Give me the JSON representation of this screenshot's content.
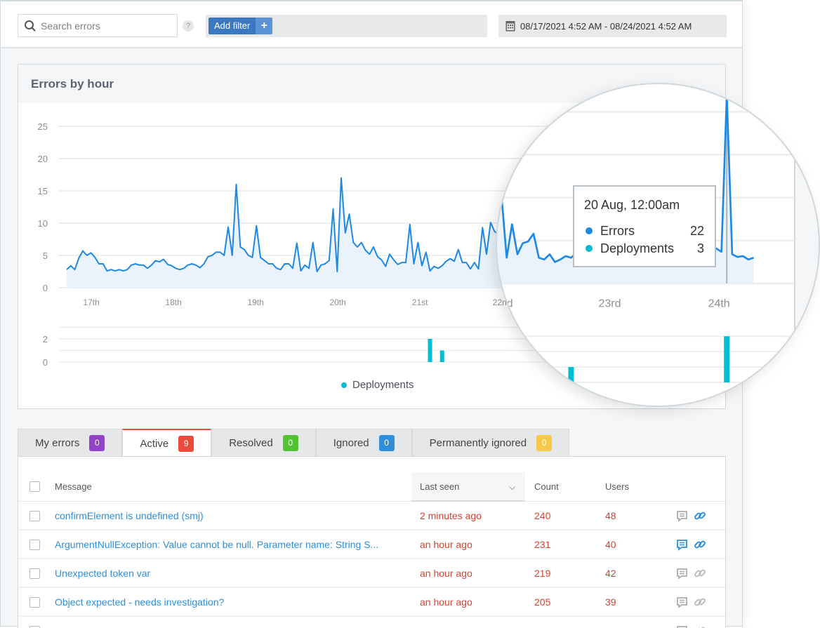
{
  "toolbar": {
    "search_placeholder": "Search errors",
    "help": "?",
    "add_filter": "Add filter",
    "add_filter_plus": "+",
    "date_range": "08/17/2021 4:52 AM - 08/24/2021 4:52 AM"
  },
  "chart_card": {
    "title": "Errors by hour"
  },
  "chart_data": [
    {
      "type": "area",
      "title": "Errors by hour",
      "series": [
        {
          "name": "Errors",
          "color": "#1e88e5",
          "values": [
            2.8,
            3.4,
            2.8,
            4.6,
            5.7,
            5.0,
            5.4,
            4.7,
            3.7,
            3.7,
            2.6,
            2.8,
            2.6,
            2.8,
            2.6,
            2.8,
            3.5,
            3.7,
            3.5,
            3.5,
            3.0,
            3.5,
            4.2,
            4.0,
            4.4,
            3.6,
            3.4,
            3.0,
            2.8,
            3.0,
            3.5,
            3.7,
            3.5,
            3.1,
            3.7,
            4.8,
            5.0,
            5.5,
            5.5,
            5.0,
            9.4,
            5.0,
            16.0,
            6.3,
            5.9,
            5.0,
            4.7,
            9.6,
            4.7,
            4.2,
            3.7,
            3.7,
            3.0,
            2.8,
            3.7,
            3.7,
            3.0,
            6.9,
            2.6,
            3.5,
            3.0,
            7.0,
            2.5,
            3.5,
            3.7,
            4.2,
            12.2,
            2.5,
            17.0,
            8.5,
            11.4,
            7.0,
            6.3,
            7.0,
            5.8,
            5.2,
            6.3,
            4.8,
            4.3,
            3.3,
            5.2,
            4.3,
            3.6,
            3.9,
            3.9,
            9.8,
            3.7,
            7.0,
            3.4,
            5.5,
            2.6,
            3.3,
            3.0,
            3.4,
            4.1,
            4.5,
            4.1,
            5.9,
            3.9,
            3.9,
            2.9,
            3.9,
            2.9,
            9.3,
            5.2,
            10.1,
            8.7,
            8.3,
            10.5,
            3.0,
            6.9,
            3.4,
            4.7,
            4.9,
            5.8,
            3.0,
            2.8,
            3.4,
            2.5,
            2.8,
            3.2,
            3.0,
            3.6,
            4.0,
            3.4,
            3.1,
            2.9,
            3.5,
            4.2,
            3.8,
            3.3,
            3.0,
            2.7,
            3.1,
            3.6,
            4.4,
            3.9,
            3.2,
            3.0,
            3.4,
            3.8,
            3.5,
            3.1,
            2.9,
            3.3,
            3.7,
            4.0,
            3.6,
            4.1,
            3.7,
            22,
            3.4,
            3.1,
            3.2,
            2.8,
            3.0
          ]
        }
      ],
      "x_ticks": [
        "17th",
        "18th",
        "19th",
        "20th",
        "21st",
        "22nd",
        "23rd",
        "24th"
      ],
      "y_ticks": [
        0,
        5,
        10,
        15,
        20,
        25
      ],
      "ylim": [
        0,
        25
      ],
      "grid": true
    },
    {
      "type": "bar",
      "series": [
        {
          "name": "Deployments",
          "color": "#00bcd4",
          "values": [
            0,
            0,
            0,
            0,
            0,
            0,
            0,
            0,
            0,
            0,
            0,
            0,
            0,
            0,
            0,
            0,
            0,
            0,
            0,
            0,
            0,
            0,
            0,
            0,
            0,
            0,
            0,
            0,
            0,
            0,
            0,
            0,
            0,
            0,
            0,
            0,
            0,
            0,
            0,
            0,
            0,
            0,
            0,
            0,
            0,
            0,
            0,
            0,
            0,
            0,
            0,
            0,
            0,
            0,
            0,
            0,
            0,
            0,
            0,
            0,
            0,
            0,
            0,
            0,
            0,
            0,
            0,
            0,
            0,
            0,
            0,
            0,
            0,
            0,
            0,
            0,
            0,
            0,
            0,
            0,
            0,
            0,
            0,
            0,
            0,
            0,
            0,
            0,
            0,
            0,
            2,
            0,
            0,
            1,
            0,
            0,
            0,
            0,
            0,
            0,
            0,
            0,
            0,
            0,
            0,
            0,
            0,
            0,
            0,
            0,
            0,
            0,
            0,
            0,
            0,
            0,
            0,
            0,
            0,
            0,
            0,
            1,
            0,
            0,
            0,
            0,
            0,
            0,
            0,
            0,
            0,
            0,
            0,
            0,
            0,
            0,
            0,
            0,
            0,
            0,
            0,
            0,
            0,
            0,
            0,
            0,
            0,
            0,
            0,
            0,
            3,
            0,
            0,
            0,
            0,
            0
          ]
        }
      ],
      "y_ticks": [
        0,
        2
      ],
      "legend": "bottom-center",
      "grid": true
    }
  ],
  "tooltip": {
    "title": "20 Aug, 12:00am",
    "rows": [
      {
        "label": "Errors",
        "value": "22",
        "color": "#1e88e5"
      },
      {
        "label": "Deployments",
        "value": "3",
        "color": "#00bcd4"
      }
    ]
  },
  "legend": {
    "deployments": "Deployments"
  },
  "tabs": [
    {
      "label": "My errors",
      "count": "0",
      "color": "#8e44c4"
    },
    {
      "label": "Active",
      "count": "9",
      "color": "#e74c3c",
      "active": true
    },
    {
      "label": "Resolved",
      "count": "0",
      "color": "#52c234"
    },
    {
      "label": "Ignored",
      "count": "0",
      "color": "#2d8fdc"
    },
    {
      "label": "Permanently ignored",
      "count": "0",
      "color": "#f7c948"
    }
  ],
  "table": {
    "columns": {
      "message": "Message",
      "last_seen": "Last seen",
      "count": "Count",
      "users": "Users"
    },
    "rows": [
      {
        "message": "confirmElement is undefined (smj)",
        "last_seen": "2 minutes ago",
        "count": "240",
        "users": "48",
        "comment_active": false,
        "link_active": true
      },
      {
        "message": "ArgumentNullException: Value cannot be null. Parameter name: String S...",
        "last_seen": "an hour ago",
        "count": "231",
        "users": "40",
        "comment_active": true,
        "link_active": true
      },
      {
        "message": "Unexpected token var",
        "last_seen": "an hour ago",
        "count": "219",
        "users": "42",
        "comment_active": false,
        "link_active": false
      },
      {
        "message": "Object expected - needs investigation?",
        "last_seen": "an hour ago",
        "count": "205",
        "users": "39",
        "comment_active": false,
        "link_active": false
      }
    ]
  }
}
